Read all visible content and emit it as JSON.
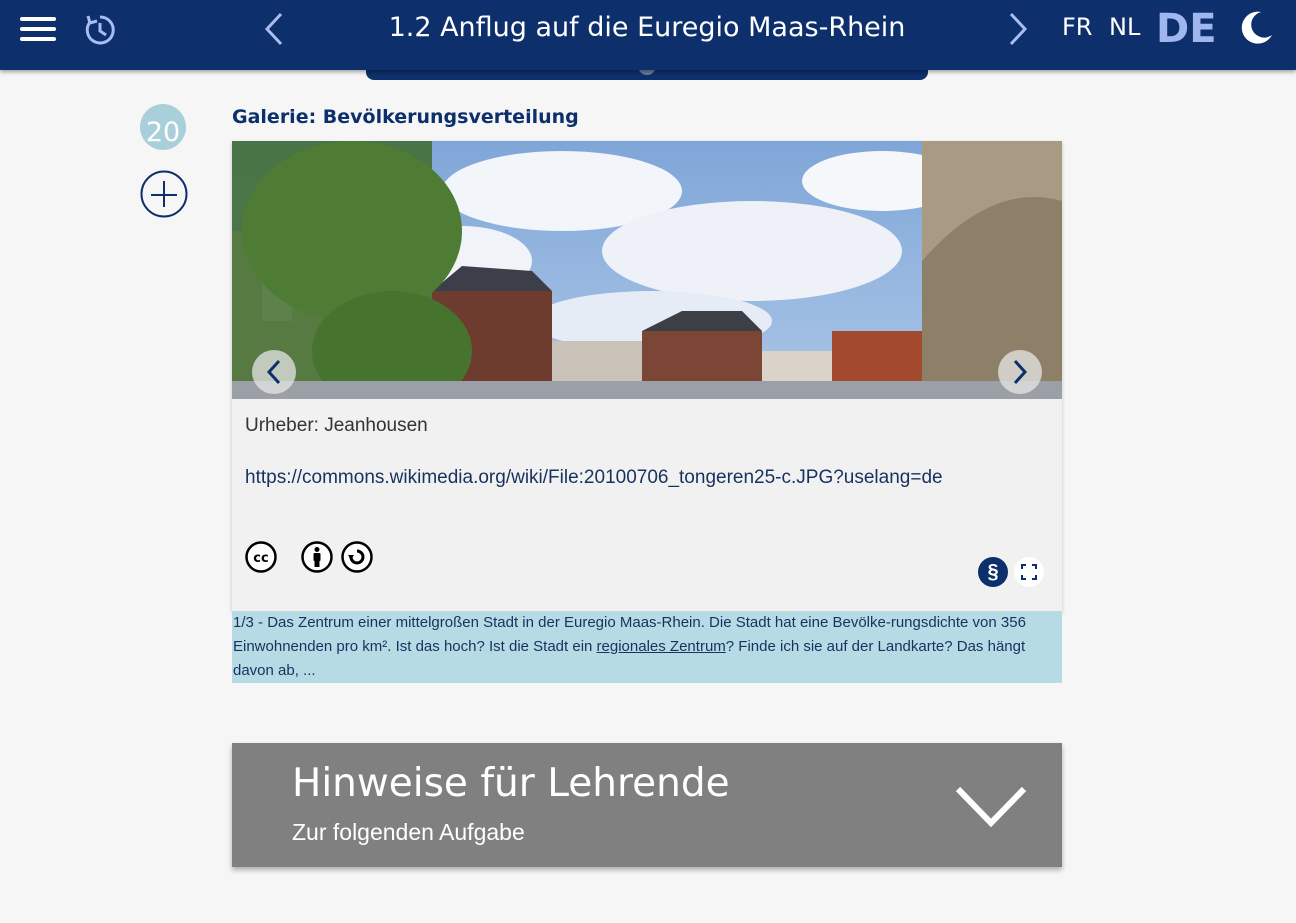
{
  "header": {
    "title": "1.2 Anflug auf die Euregio Maas-Rhein",
    "languages": [
      "FR",
      "NL",
      "DE"
    ],
    "active_language": "DE"
  },
  "sidebar": {
    "number_badge": "20"
  },
  "gallery": {
    "title": "Galerie: Bevölkerungsverteilung",
    "author": "Urheber: Jeanhousen",
    "source_url": "https://commons.wikimedia.org/wiki/File:20100706_tongeren25-c.JPG?uselang=de",
    "license_icons": [
      "cc-icon",
      "by-icon",
      "sa-icon"
    ],
    "license_button": "§",
    "caption": {
      "counter": "1/3",
      "text_before": " - Das Zentrum einer mittelgroßen Stadt in der Euregio Maas-Rhein. Die Stadt hat eine Bevölke-rungsdichte von 356 Einwohnenden pro km². Ist das hoch? Ist die Stadt ein ",
      "link": "regionales Zentrum",
      "text_after": "? Finde ich sie auf der Landkarte? Das hängt davon ab, ..."
    }
  },
  "hints": {
    "title": "Hinweise für Lehrende",
    "subtitle": "Zur folgenden Aufgabe"
  },
  "colors": {
    "header_bg": "#0d2f6c",
    "active_language": "#9fb6ee",
    "caption_bg": "#b6dbe5",
    "hints_bg": "#808080",
    "badge_bg": "#a9cfdb"
  }
}
